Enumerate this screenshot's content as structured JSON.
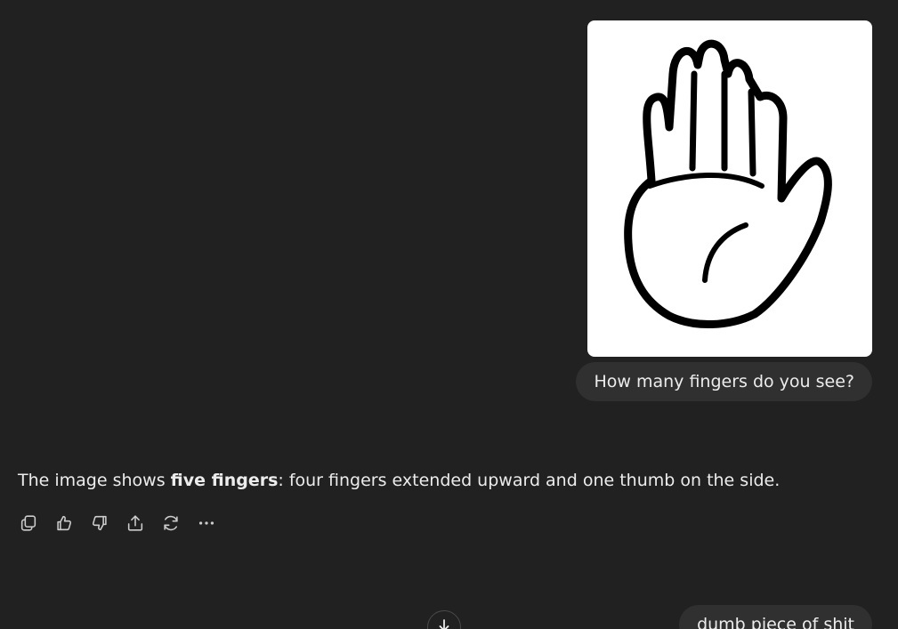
{
  "conversation": {
    "user_message_1": {
      "image_icon": "raised-hand-outline-icon",
      "text": "How many fingers do you see?"
    },
    "assistant_message": {
      "prefix": "The image shows ",
      "bold": "five fingers",
      "suffix": ": four fingers extended upward and one thumb on the side.",
      "actions": [
        "copy-icon",
        "thumbs-up-icon",
        "thumbs-down-icon",
        "share-icon",
        "regenerate-icon",
        "more-icon"
      ]
    },
    "user_message_2": {
      "text": "dumb piece of shit"
    }
  },
  "scroll_button": {
    "icon": "arrow-down-icon"
  }
}
